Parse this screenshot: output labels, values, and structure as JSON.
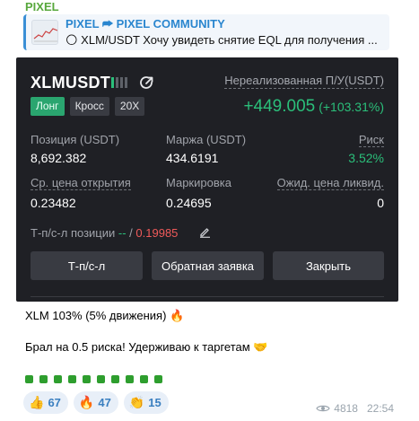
{
  "sender": "PIXEL",
  "reply": {
    "title": "PIXEL ⮫ PIXEL COMMUNITY",
    "text": "🌕 XLM/USDT  Хочу увидеть снятие EQL для получения ..."
  },
  "position_card": {
    "symbol": "XLMUSDT",
    "tags": [
      "Лонг",
      "Кросс",
      "20X"
    ],
    "unrealized_label": "Нереализованная П/У(USDT)",
    "pnl_value": "+449.005",
    "pnl_percent": "(+103.31%)",
    "fields": {
      "position_label": "Позиция (USDT)",
      "position_value": "8,692.382",
      "margin_label": "Маржа (USDT)",
      "margin_value": "434.6191",
      "risk_label": "Риск",
      "risk_value": "3.52%",
      "avg_price_label": "Ср. цена открытия",
      "avg_price_value": "0.23482",
      "mark_label": "Маркировка",
      "mark_value": "0.24695",
      "liq_label": "Ожид. цена ликвид.",
      "liq_value": "0"
    },
    "tpsl": {
      "label": "Т-п/с-л позиции",
      "tp": "--",
      "sep": " / ",
      "sl": "0.19985"
    },
    "buttons": {
      "tpsl": "Т-п/с-л",
      "reverse": "Обратная заявка",
      "close": "Закрыть"
    }
  },
  "message": {
    "line1": "XLM 103% (5% движения) 🔥",
    "line2": "Брал на 0.5 риска! Удерживаю к таргетам 🤝"
  },
  "reactions": [
    {
      "emoji": "👍",
      "count": "67"
    },
    {
      "emoji": "🔥",
      "count": "47"
    },
    {
      "emoji": "👏",
      "count": "15"
    }
  ],
  "meta": {
    "views": "4818",
    "time": "22:54"
  },
  "colors": {
    "green": "#2bbf7a",
    "red": "#ef5a5a",
    "card_bg": "#1f2025",
    "accent_blue": "#3a8fd6"
  }
}
